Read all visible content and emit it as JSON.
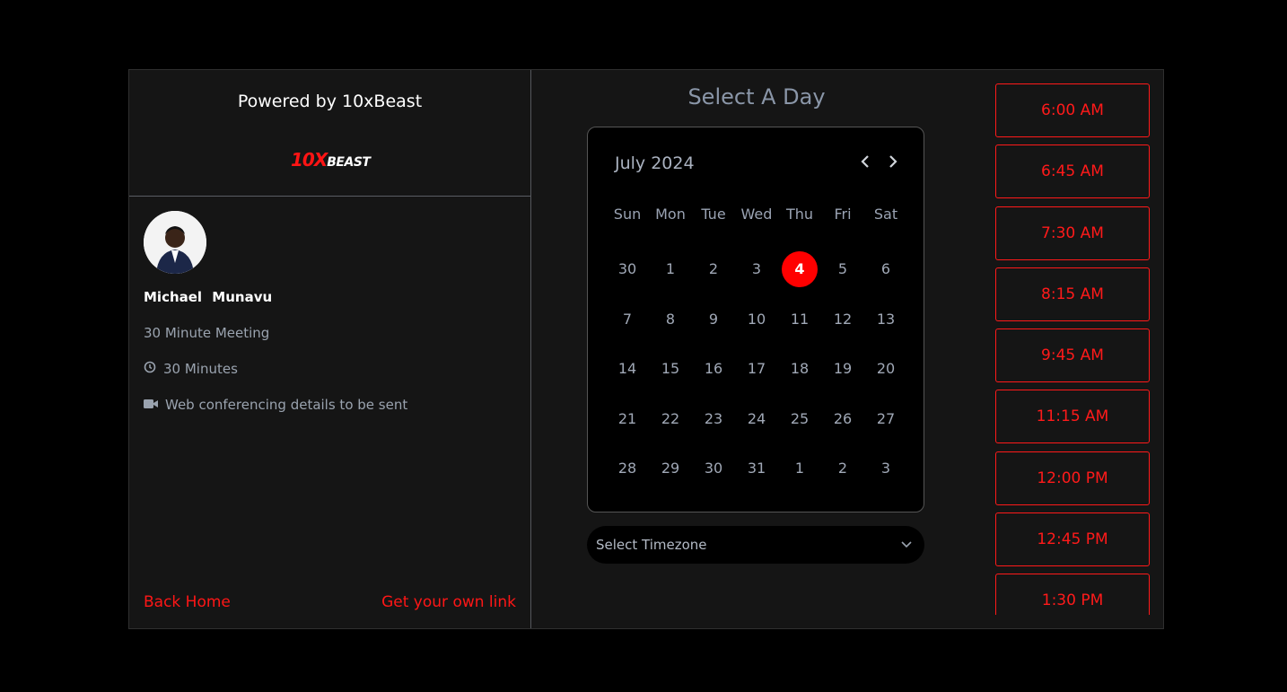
{
  "brand": {
    "powered_by": "Powered by 10xBeast",
    "logo_part1": "10X",
    "logo_part2": "BEAST"
  },
  "host": {
    "name": "Michael   Munavu",
    "meeting_title": "30 Minute Meeting",
    "duration": "30 Minutes",
    "location": "Web conferencing details to be sent"
  },
  "links": {
    "back_home": "Back Home",
    "get_own_link": "Get your own link"
  },
  "calendar": {
    "heading": "Select A Day",
    "month_label": "July 2024",
    "weekdays": [
      "Sun",
      "Mon",
      "Tue",
      "Wed",
      "Thu",
      "Fri",
      "Sat"
    ],
    "days": [
      "30",
      "1",
      "2",
      "3",
      "4",
      "5",
      "6",
      "7",
      "8",
      "9",
      "10",
      "11",
      "12",
      "13",
      "14",
      "15",
      "16",
      "17",
      "18",
      "19",
      "20",
      "21",
      "22",
      "23",
      "24",
      "25",
      "26",
      "27",
      "28",
      "29",
      "30",
      "31",
      "1",
      "2",
      "3"
    ],
    "selected_day": "4"
  },
  "timezone": {
    "placeholder": "Select Timezone"
  },
  "time_slots": [
    "6:00 AM",
    "6:45 AM",
    "7:30 AM",
    "8:15 AM",
    "9:45 AM",
    "11:15 AM",
    "12:00 PM",
    "12:45 PM",
    "1:30 PM"
  ],
  "colors": {
    "accent": "#ff0000",
    "panel": "#151515",
    "background": "#000000",
    "muted_text": "#9aa3af"
  }
}
